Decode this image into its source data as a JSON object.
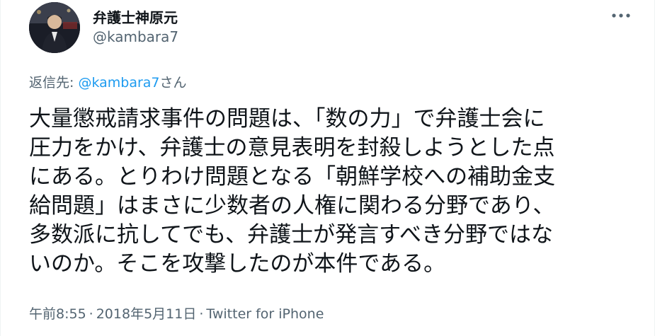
{
  "author": {
    "display_name": "弁護士神原元",
    "handle": "@kambara7"
  },
  "more_icon": "more-dots-icon",
  "reply": {
    "prefix": "返信先: ",
    "mention": "@kambara7",
    "suffix": "さん"
  },
  "tweet": {
    "lines": [
      "大量懲戒請求事件の問題は、「数の力」で弁護士会に",
      "圧力をかけ、弁護士の意見表明を封殺しようとした点",
      "にある。とりわけ問題となる「朝鮮学校への補助金支",
      "給問題」はまさに少数者の人権に関わる分野であり、",
      "多数派に抗してでも、弁護士が発言すべき分野ではな",
      "いのか。そこを攻撃したのが本件である。"
    ]
  },
  "meta": {
    "time": "午前8:55",
    "separator": "·",
    "date": "2018年5月11日",
    "source": "Twitter for iPhone"
  },
  "colors": {
    "text": "#0f1419",
    "secondary": "#536471",
    "accent": "#1d9bf0"
  }
}
